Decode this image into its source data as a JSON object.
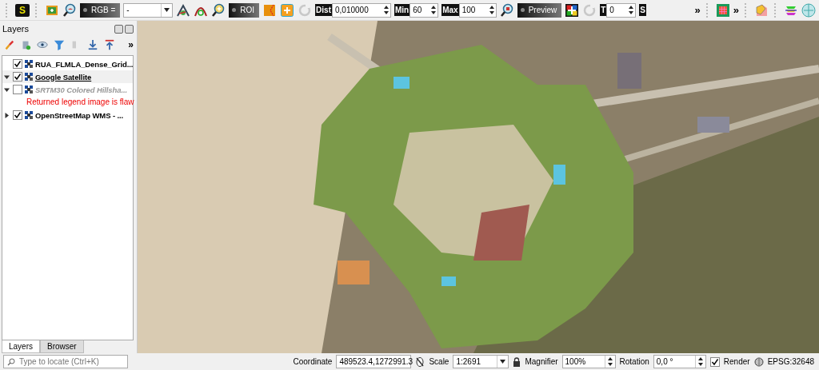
{
  "toolbar": {
    "items": [
      {
        "kind": "grip"
      },
      {
        "kind": "key",
        "text": "S"
      },
      {
        "kind": "grip"
      },
      {
        "kind": "icon"
      },
      {
        "kind": "icon"
      },
      {
        "kind": "dark-button",
        "text": "RGB ="
      },
      {
        "kind": "combo",
        "text": "-"
      },
      {
        "kind": "icon"
      },
      {
        "kind": "icon"
      },
      {
        "kind": "icon"
      },
      {
        "kind": "dark-button",
        "text": "ROI"
      },
      {
        "kind": "icon"
      },
      {
        "kind": "icon"
      },
      {
        "kind": "icon"
      },
      {
        "kind": "label",
        "text": "Dist"
      },
      {
        "kind": "spin",
        "text": "0,010000"
      },
      {
        "kind": "label",
        "text": "Min"
      },
      {
        "kind": "spin",
        "text": "60"
      },
      {
        "kind": "label",
        "text": "Max"
      },
      {
        "kind": "spin",
        "text": "100"
      },
      {
        "kind": "icon"
      },
      {
        "kind": "dark-button",
        "text": "Preview"
      },
      {
        "kind": "icon"
      },
      {
        "kind": "icon"
      },
      {
        "kind": "label",
        "text": "T"
      },
      {
        "kind": "spin",
        "text": "0"
      },
      {
        "kind": "label",
        "text": "S"
      },
      {
        "kind": "chevron",
        "text": "»"
      },
      {
        "kind": "grip"
      },
      {
        "kind": "icon"
      },
      {
        "kind": "chevron",
        "text": "»"
      },
      {
        "kind": "grip"
      },
      {
        "kind": "icon"
      },
      {
        "kind": "grip"
      },
      {
        "kind": "icon"
      },
      {
        "kind": "icon"
      }
    ]
  },
  "layers_panel": {
    "title": "Layers",
    "toolbar_overflow": "»",
    "layers": [
      {
        "kind": "leaf",
        "name": "RUA_FLMLA_Dense_Grid...",
        "checked": true,
        "selected": false
      },
      {
        "kind": "node",
        "name": "Google Satellite",
        "checked": true,
        "selected": true,
        "expanded": true
      },
      {
        "kind": "node",
        "name": "SRTM30 Colored Hillsha...",
        "checked": false,
        "selected": false,
        "expanded": true,
        "children": [
          {
            "kind": "error",
            "text": "Returned legend image is flaw"
          }
        ]
      },
      {
        "kind": "node",
        "name": "OpenStreetMap WMS - ...",
        "checked": true,
        "selected": false,
        "expanded": false
      }
    ],
    "tabs": [
      {
        "label": "Layers",
        "selected": true
      },
      {
        "label": "Browser",
        "selected": false
      }
    ],
    "locator": {
      "placeholder": "Type to locate (Ctrl+K)"
    }
  },
  "status_bar": {
    "coordinate_label": "Coordinate",
    "coordinate": "489523.4,1272991.3",
    "scale_label": "Scale",
    "scale": "1:2691",
    "magnifier_label": "Magnifier",
    "magnifier": "100%",
    "rotation_label": "Rotation",
    "rotation": "0,0 °",
    "render": {
      "label": "Render",
      "checked": true
    },
    "crs": "EPSG:32648"
  }
}
